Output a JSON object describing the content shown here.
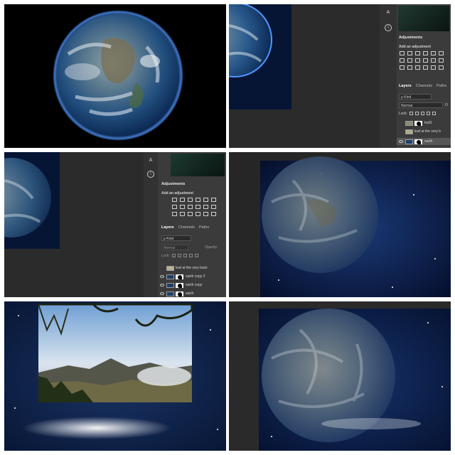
{
  "panel_a": {
    "adjustments_tab": "Adjustments",
    "add_adjustment": "Add an adjustment",
    "tabs": [
      "Layers",
      "Channels",
      "Paths"
    ],
    "kind": "ρ Kind",
    "blend_mode": "Normal",
    "opacity_cut": "O",
    "lock_label": "Lock:",
    "layers": [
      {
        "name": "leaf1",
        "visible": false,
        "selected": false
      },
      {
        "name": "leaf at the very b",
        "visible": false,
        "selected": false
      },
      {
        "name": "earth",
        "visible": true,
        "selected": true
      }
    ]
  },
  "panel_b": {
    "adjustments_tab": "Adjustments",
    "add_adjustment": "Add an adjustment",
    "tabs": [
      "Layers",
      "Channels",
      "Paths"
    ],
    "kind": "ρ Kind",
    "blend_mode": "Normal",
    "opacity_label": "Opacity:",
    "lock_label": "Lock:",
    "layers": [
      {
        "name": "leaf at the very back",
        "visible": false,
        "selected": false
      },
      {
        "name": "earth copy 2",
        "visible": true,
        "selected": false
      },
      {
        "name": "earth copy",
        "visible": true,
        "selected": false
      },
      {
        "name": "earth",
        "visible": true,
        "selected": false
      }
    ]
  },
  "tools": {
    "text_tool_glyph": "A",
    "info_glyph": "i"
  },
  "colors": {
    "ps_dark": "#2b2b2b",
    "ps_panel": "#3b3b3b",
    "space_blue": "#0b1c45"
  }
}
